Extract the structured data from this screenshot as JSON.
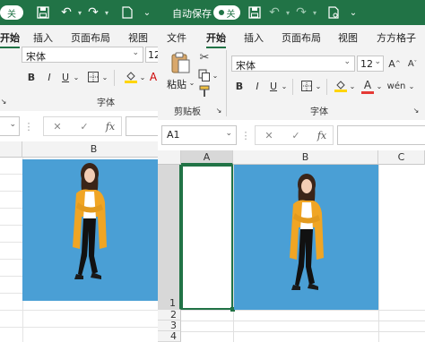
{
  "left_window": {
    "autosave_toggle": "关",
    "tabs": [
      "开始",
      "插入",
      "页面布局",
      "视图"
    ],
    "active_tab": "开始",
    "font_name": "宋体",
    "font_size_partial": "12",
    "font_group_label": "字体",
    "column_b": "B"
  },
  "right_window": {
    "autosave_label": "自动保存",
    "autosave_toggle": "关",
    "tabs": [
      "文件",
      "开始",
      "插入",
      "页面布局",
      "视图",
      "方方格子"
    ],
    "active_tab": "开始",
    "paste_label": "粘贴",
    "clipboard_group_label": "剪贴板",
    "font_name": "宋体",
    "font_size": "12",
    "font_group_label": "字体",
    "name_box": "A1",
    "fx_label": "fx",
    "columns": [
      "A",
      "B",
      "C"
    ],
    "rows": [
      "1",
      "2",
      "3",
      "4"
    ]
  },
  "colors": {
    "titlebar": "#217346",
    "ribbon": "#f3f3f3",
    "picture_bg": "#4a9fd5",
    "selection": "#217346",
    "fill_color": "#ffd500",
    "font_color": "#e53935"
  },
  "icons": [
    "save-icon",
    "undo-icon",
    "redo-icon",
    "paste-icon",
    "cut-icon",
    "copy-icon",
    "format-painter-icon",
    "fill-color-icon",
    "font-color-icon",
    "borders-icon",
    "cancel-icon",
    "enter-icon",
    "function-icon"
  ]
}
